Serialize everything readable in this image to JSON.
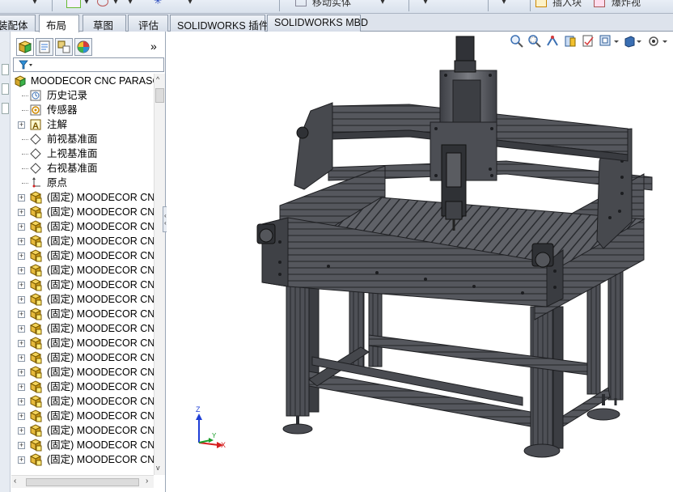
{
  "toolbar": {
    "move_body": "移动实体",
    "insert_block": "插入块",
    "explode_view": "爆炸视"
  },
  "tabs": [
    {
      "label": "装配体",
      "active": false
    },
    {
      "label": "布局",
      "active": true
    },
    {
      "label": "草图",
      "active": false
    },
    {
      "label": "评估",
      "active": false
    },
    {
      "label": "SOLIDWORKS 插件",
      "active": false
    },
    {
      "label": "SOLIDWORKS MBD",
      "active": false
    }
  ],
  "feature_manager": {
    "tabs": [
      "feature-manager",
      "property-manager",
      "configuration-manager",
      "display-manager"
    ],
    "more": "»",
    "filter_icon": "funnel-icon",
    "tree": {
      "root": "MOODECOR CNC PARASOLID",
      "items": [
        {
          "label": "历史记录",
          "icon": "history-icon"
        },
        {
          "label": "传感器",
          "icon": "sensor-icon"
        },
        {
          "label": "注解",
          "icon": "annotation-icon",
          "expandable": true
        },
        {
          "label": "前视基准面",
          "icon": "plane-icon"
        },
        {
          "label": "上视基准面",
          "icon": "plane-icon"
        },
        {
          "label": "右视基准面",
          "icon": "plane-icon"
        },
        {
          "label": "原点",
          "icon": "origin-icon"
        }
      ],
      "parts": [
        "(固定) MOODECOR CN",
        "(固定) MOODECOR CN",
        "(固定) MOODECOR CN",
        "(固定) MOODECOR CN",
        "(固定) MOODECOR CN",
        "(固定) MOODECOR CN",
        "(固定) MOODECOR CN",
        "(固定) MOODECOR CN",
        "(固定) MOODECOR CN",
        "(固定) MOODECOR CN",
        "(固定) MOODECOR CN",
        "(固定) MOODECOR CN",
        "(固定) MOODECOR CN",
        "(固定) MOODECOR CN",
        "(固定) MOODECOR CN",
        "(固定) MOODECOR CN",
        "(固定) MOODECOR CN",
        "(固定) MOODECOR CN",
        "(固定) MOODECOR CN"
      ]
    }
  },
  "triad": {
    "x": "X",
    "y": "Y",
    "z": "Z"
  },
  "colors": {
    "x_axis": "#d61f1f",
    "y_axis": "#1a9e2a",
    "z_axis": "#1f3fd6",
    "machine": "#505258"
  }
}
